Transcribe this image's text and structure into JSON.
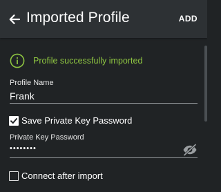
{
  "appbar": {
    "title": "Imported Profile",
    "add_label": "ADD",
    "back_icon": "arrow-left-icon"
  },
  "banner": {
    "icon": "info-icon",
    "text": "Profile successfully imported",
    "color": "#8ec541"
  },
  "profile_name": {
    "label": "Profile Name",
    "value": "Frank"
  },
  "save_password": {
    "label": "Save Private Key Password",
    "checked": true
  },
  "private_key_password": {
    "label": "Private Key Password",
    "masked_value": "••••••••",
    "visibility_icon": "eye-off-icon"
  },
  "connect_after_import": {
    "label": "Connect after import",
    "checked": false
  },
  "colors": {
    "background": "#202325",
    "appbar": "#2d3134",
    "accent": "#8ec541"
  }
}
